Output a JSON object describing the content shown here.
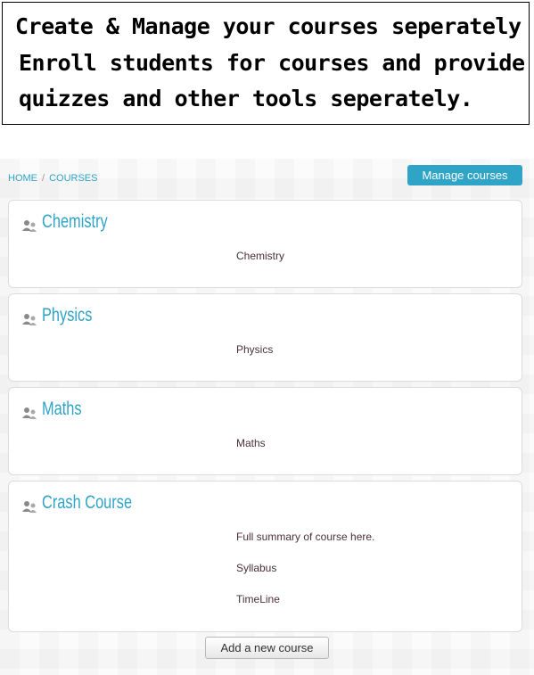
{
  "banner": {
    "line1": "Create & Manage your courses seperately",
    "line2": "Enroll students for courses and provide",
    "line3": "quizzes and other tools seperately."
  },
  "breadcrumb": {
    "home": "HOME",
    "separator": "/",
    "courses": "COURSES"
  },
  "manage_courses_label": "Manage courses",
  "courses": [
    {
      "title": "Chemistry",
      "summary": [
        "Chemistry"
      ]
    },
    {
      "title": "Physics",
      "summary": [
        "Physics"
      ]
    },
    {
      "title": "Maths",
      "summary": [
        "Maths"
      ]
    },
    {
      "title": "Crash Course",
      "summary": [
        "Full summary of course here.",
        "Syllabus",
        "TimeLine"
      ]
    }
  ],
  "add_course_label": "Add a new course",
  "colors": {
    "accent": "#2fa4c7",
    "summary_text": "#4a2f3a"
  },
  "icons": {
    "course": "course-people-icon"
  }
}
